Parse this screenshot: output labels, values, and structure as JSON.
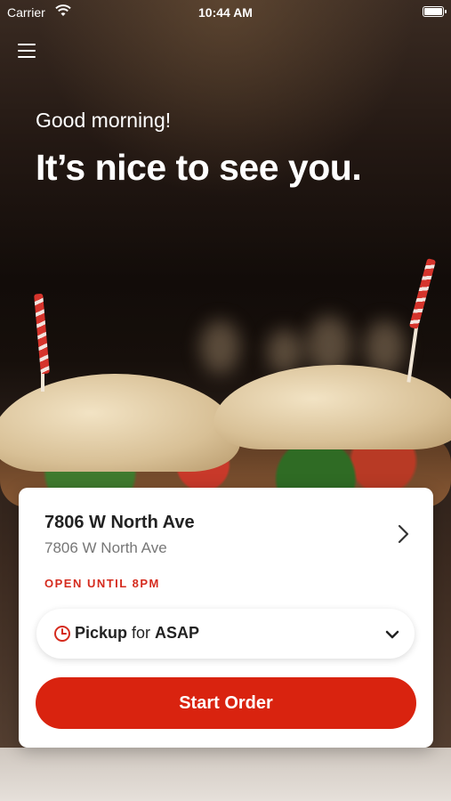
{
  "status_bar": {
    "carrier": "Carrier",
    "time": "10:44 AM"
  },
  "header": {
    "greeting": "Good morning!",
    "headline": "It’s nice to see you."
  },
  "location_card": {
    "name": "7806 W North Ave",
    "address": "7806 W North Ave",
    "hours": "OPEN UNTIL 8PM",
    "pickup": {
      "method": "Pickup",
      "connector": "for",
      "time": "ASAP"
    },
    "start_button": "Start Order"
  },
  "icons": [
    "menu-icon",
    "wifi-icon",
    "battery-icon",
    "chevron-right-icon",
    "clock-icon",
    "chevron-down-icon"
  ],
  "colors": {
    "accent": "#d9230f",
    "hours_text": "#d52b1e"
  }
}
